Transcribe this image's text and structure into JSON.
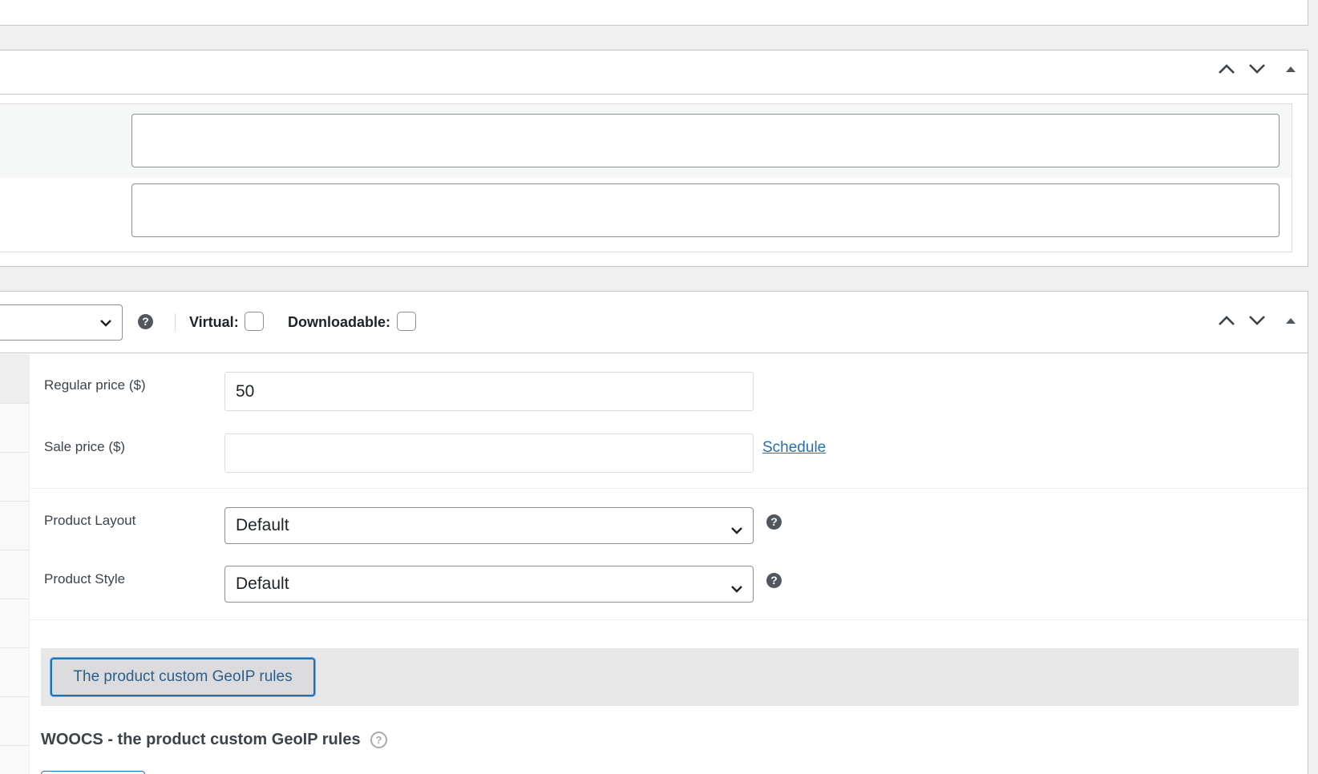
{
  "header_controls": {
    "move_up_icon": "chevron-up-icon",
    "move_down_icon": "chevron-down-icon",
    "toggle_icon": "triangle-up-icon"
  },
  "meta_fields": [
    {
      "value": ""
    },
    {
      "value": ""
    }
  ],
  "product_data": {
    "type_select_value": "",
    "help_glyph": "?",
    "virtual_label": "Virtual:",
    "downloadable_label": "Downloadable:",
    "virtual_checked": false,
    "downloadable_checked": false
  },
  "general": {
    "regular_price_label": "Regular price ($)",
    "regular_price_value": "50",
    "sale_price_label": "Sale price ($)",
    "sale_price_value": "",
    "schedule_link": "Schedule",
    "product_layout_label": "Product Layout",
    "product_layout_value": "Default",
    "product_style_label": "Product Style",
    "product_style_value": "Default"
  },
  "geoip": {
    "button_label": "The product custom GeoIP rules",
    "section_title": "WOOCS - the product custom GeoIP rules",
    "help_glyph": "?"
  },
  "colors": {
    "accent": "#2271b1",
    "border": "#c3c4c7",
    "background": "#f0f0f1"
  }
}
